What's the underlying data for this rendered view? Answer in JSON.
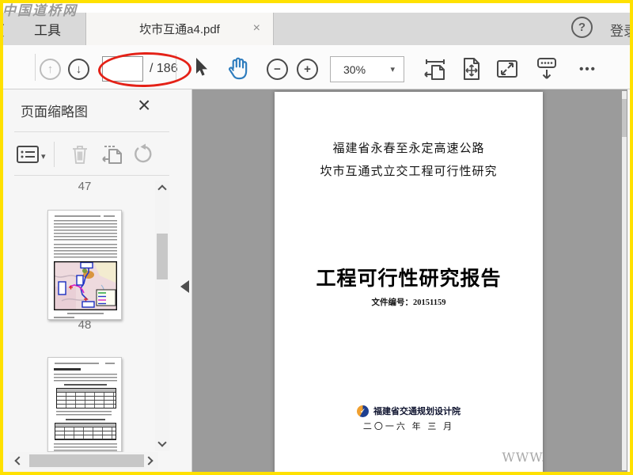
{
  "window": {
    "watermark_top": "中国道桥网",
    "page_watermark": "WWW."
  },
  "tabbar": {
    "home_tab_partial": "页",
    "tools_tab": "工具",
    "doc_tab": "坎市互通a4.pdf",
    "login_partial": "登录"
  },
  "toolbar": {
    "page_input": "",
    "page_total": "/ 186",
    "zoom_level": "30%"
  },
  "sidebar": {
    "panel_title": "页面缩略图",
    "thumbnails": [
      {
        "page": "47"
      },
      {
        "page": "48"
      }
    ]
  },
  "document": {
    "header_line1": "福建省永春至永定高速公路",
    "header_line2": "坎市互通式立交工程可行性研究",
    "main_title": "工程可行性研究报告",
    "doc_number": "文件编号：20151159",
    "organization": "福建省交通规划设计院",
    "date": "二〇一六 年 三 月"
  },
  "icons": {
    "help": "?",
    "close": "×",
    "prev_page": "↑",
    "next_page": "↓",
    "zoom_out": "−",
    "zoom_in": "+",
    "caret": "▾",
    "more": "•••",
    "logo_check": "✓"
  },
  "colors": {
    "frame_border": "#ffe100",
    "tabbar_bg": "#d9d9d9",
    "toolbar_bg": "#fbfbfb",
    "doc_bg": "#9b9b9b",
    "hand_tool_blue": "#2f7dbe",
    "annotation_red": "#e42117"
  }
}
